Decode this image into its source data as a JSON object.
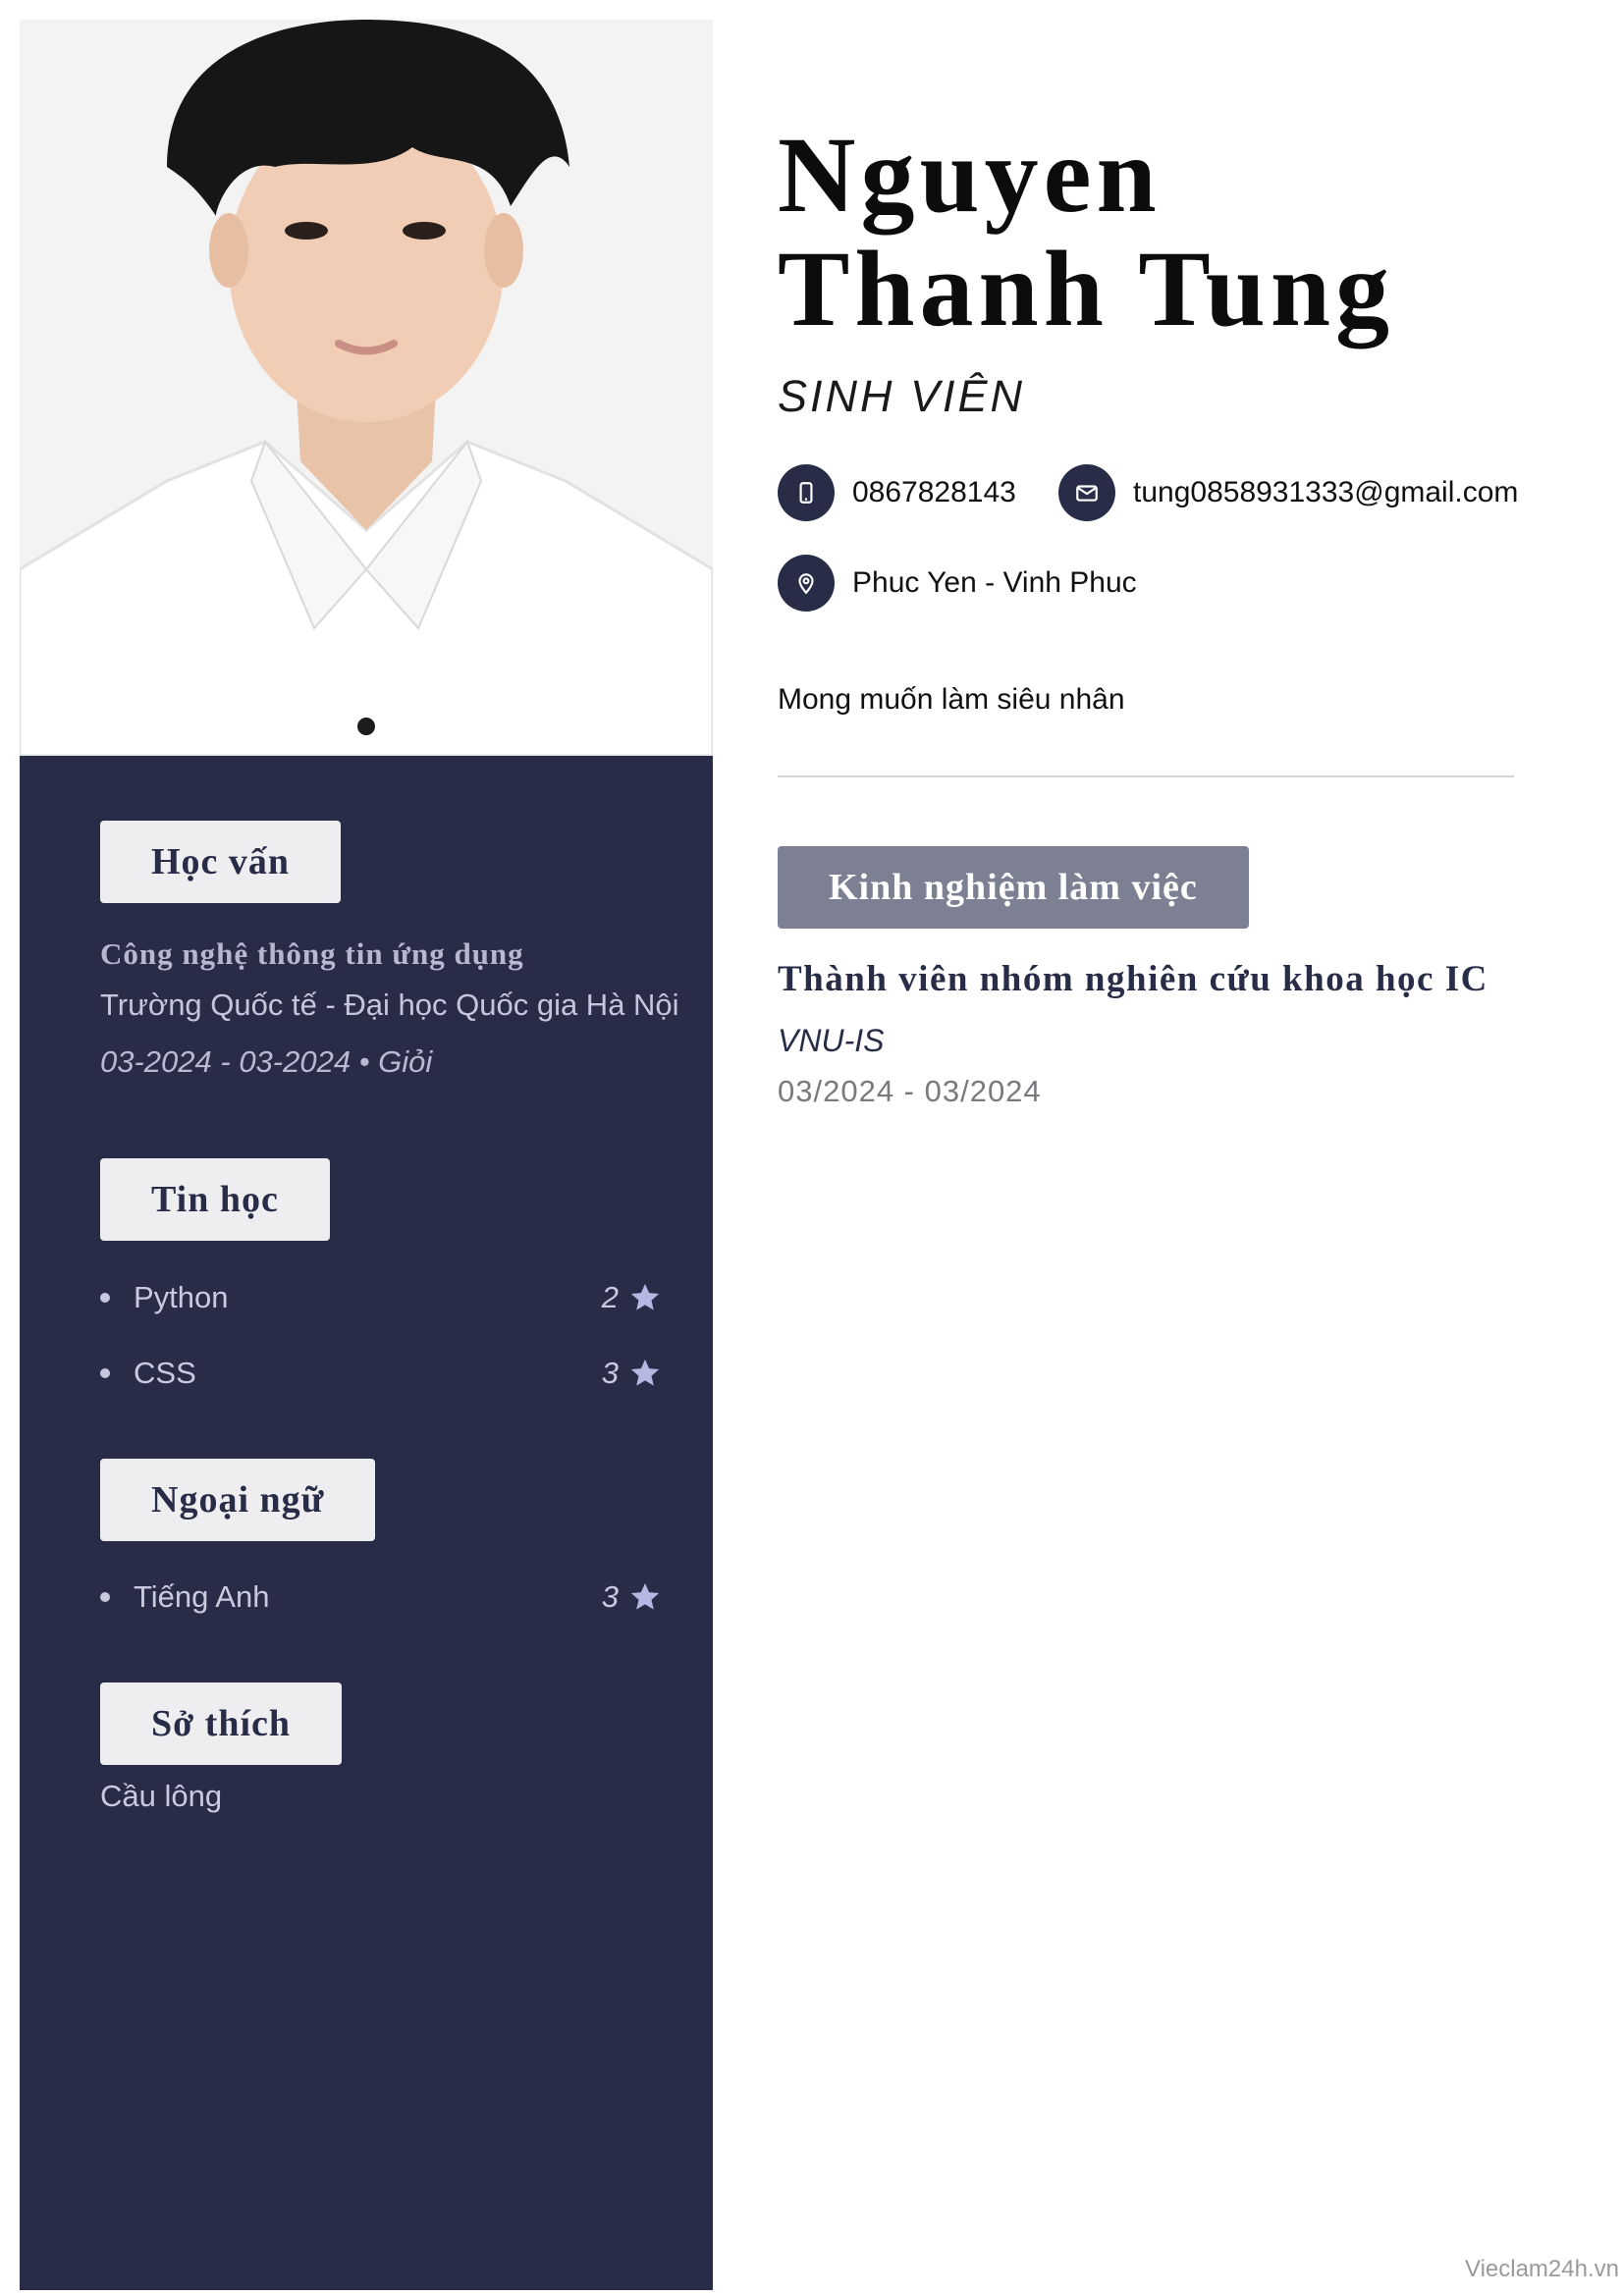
{
  "header": {
    "name_line1": "Nguyen",
    "name_line2": "Thanh Tung",
    "title": "SINH VIÊN"
  },
  "contact": {
    "phone": "0867828143",
    "email": "tung0858931333@gmail.com",
    "address": "Phuc Yen - Vinh Phuc",
    "icons": {
      "phone": "mobile-phone-icon",
      "email": "envelope-icon",
      "address": "map-pin-icon"
    }
  },
  "objective": "Mong muốn làm siêu nhân",
  "education": {
    "heading": "Học vấn",
    "major": "Công nghệ thông tin ứng dụng",
    "school": "Trường Quốc tế - Đại học Quốc gia Hà Nội",
    "period_grade": "03-2024 - 03-2024 • Giỏi"
  },
  "it_skills": {
    "heading": "Tin học",
    "items": [
      {
        "name": "Python",
        "level": "2"
      },
      {
        "name": "CSS",
        "level": "3"
      }
    ]
  },
  "languages": {
    "heading": "Ngoại ngữ",
    "items": [
      {
        "name": "Tiếng Anh",
        "level": "3"
      }
    ]
  },
  "hobbies": {
    "heading": "Sở thích",
    "text": "Cầu lông"
  },
  "experience": {
    "heading": "Kinh nghiệm làm việc",
    "items": [
      {
        "role": "Thành viên nhóm nghiên cứu khoa học IC",
        "org": "VNU-IS",
        "period": "03/2024 - 03/2024"
      }
    ]
  },
  "footer": {
    "watermark": "Vieclam24h.vn"
  },
  "colors": {
    "sidebar": "#282c47",
    "tag_bg": "#eeeef1",
    "exp_tag_bg": "#7d8093",
    "star": "#b4b8e2"
  }
}
